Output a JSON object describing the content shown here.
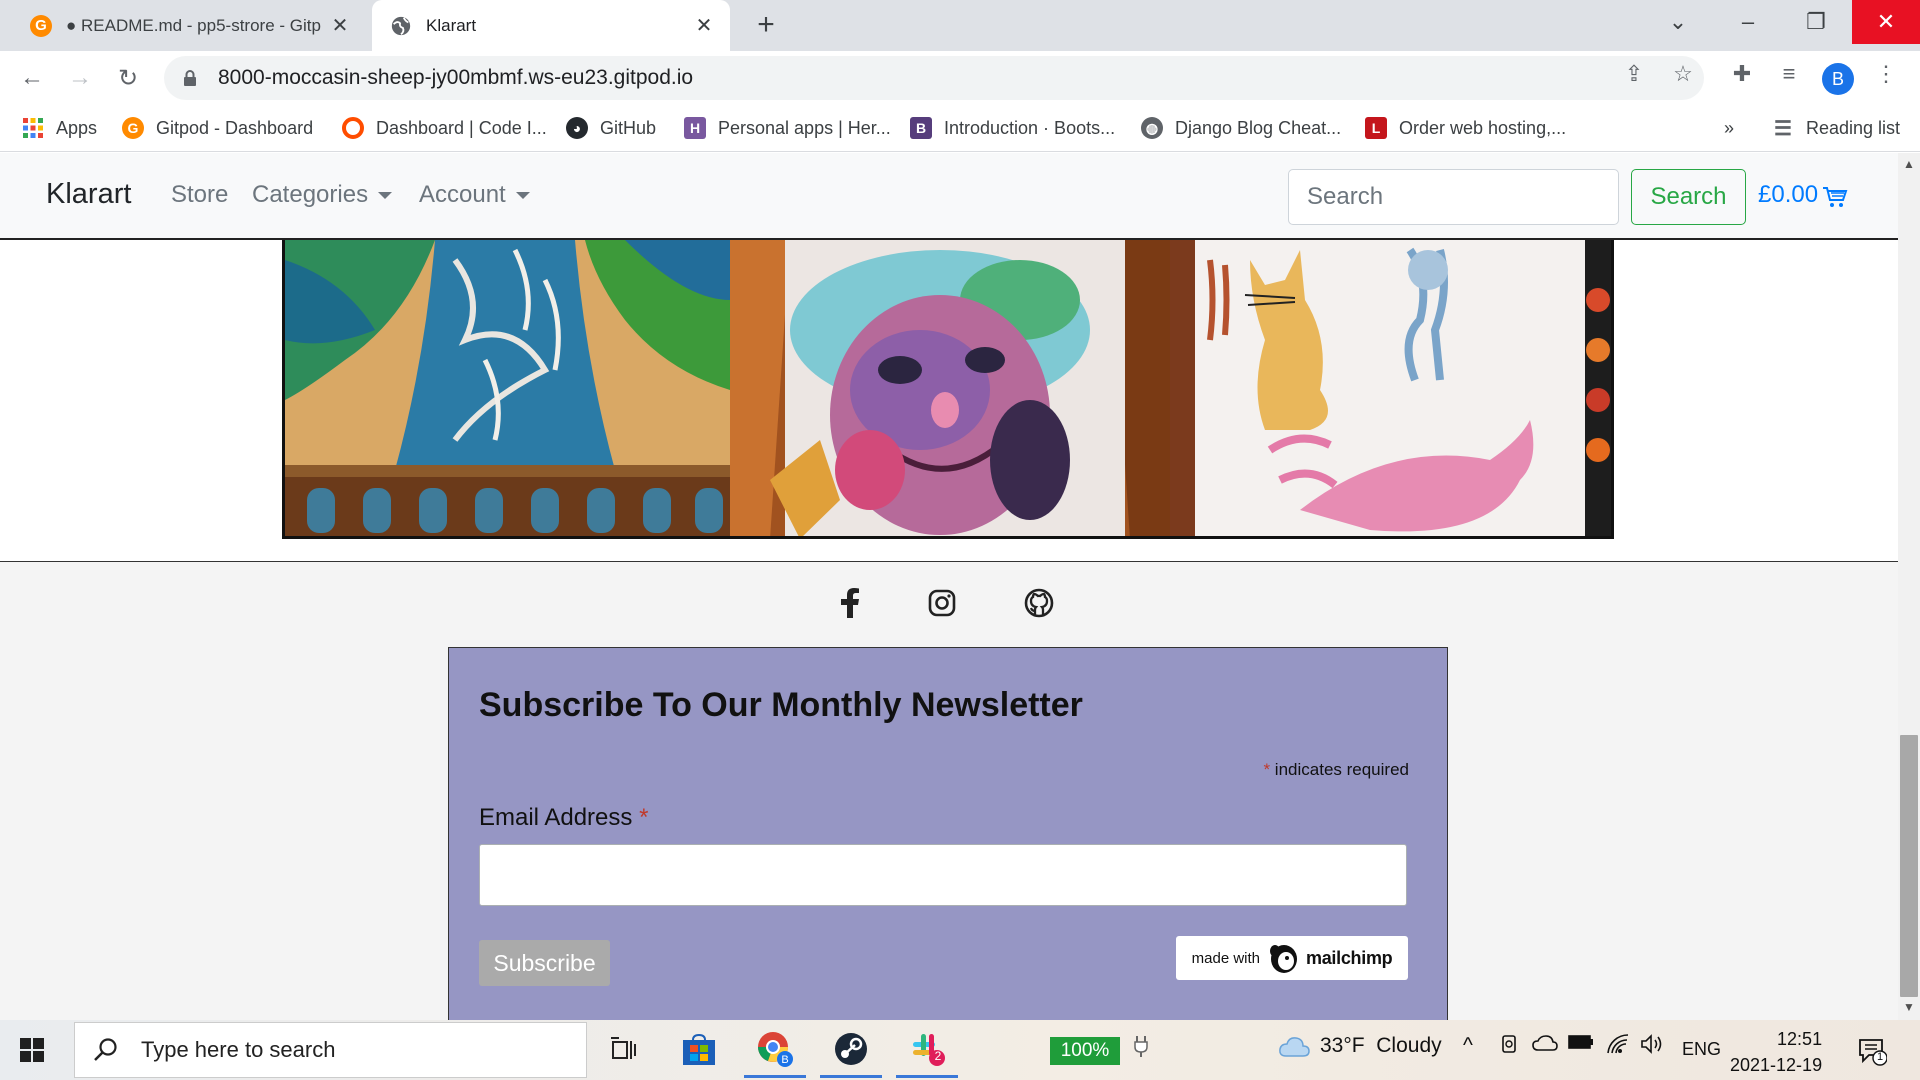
{
  "browser": {
    "tabs": [
      {
        "title": "● README.md - pp5-strore - Gitp",
        "active": false
      },
      {
        "title": "Klarart",
        "active": true
      }
    ],
    "url": "8000-moccasin-sheep-jy00mbmf.ws-eu23.gitpod.io",
    "profile_initial": "B",
    "bookmarks": [
      {
        "label": "Apps",
        "icon": "apps-grid-icon"
      },
      {
        "label": "Gitpod - Dashboard",
        "icon": "gitpod-icon"
      },
      {
        "label": "Dashboard | Code I...",
        "icon": "code-institute-icon"
      },
      {
        "label": "GitHub",
        "icon": "github-icon"
      },
      {
        "label": "Personal apps | Her...",
        "icon": "heroku-icon"
      },
      {
        "label": "Introduction · Boots...",
        "icon": "bootstrap-icon"
      },
      {
        "label": "Django Blog Cheat...",
        "icon": "globe-icon"
      },
      {
        "label": "Order web hosting,...",
        "icon": "hosting-icon"
      }
    ],
    "reading_list": "Reading list",
    "overflow": "»"
  },
  "site": {
    "brand": "Klarart",
    "nav": {
      "store": "Store",
      "categories": "Categories",
      "account": "Account"
    },
    "search_placeholder": "Search",
    "search_button": "Search",
    "cart_total": "£0.00"
  },
  "newsletter": {
    "title": "Subscribe To Our Monthly Newsletter",
    "required_asterisk": "*",
    "required_note": "indicates required",
    "email_label": "Email Address",
    "email_value": "",
    "subscribe_button": "Subscribe",
    "badge_prefix": "made with",
    "badge_brand": "mailchimp"
  },
  "taskbar": {
    "search_placeholder": "Type here to search",
    "battery_percent": "100%",
    "weather": "33°F  Cloudy",
    "language": "ENG",
    "time": "12:51",
    "date": "2021-12-19",
    "slack_badge": "2",
    "notification_count": "1"
  },
  "colors": {
    "brand_success": "#28a745",
    "brand_primary": "#007bff",
    "newsletter_bg": "#9696c4"
  }
}
